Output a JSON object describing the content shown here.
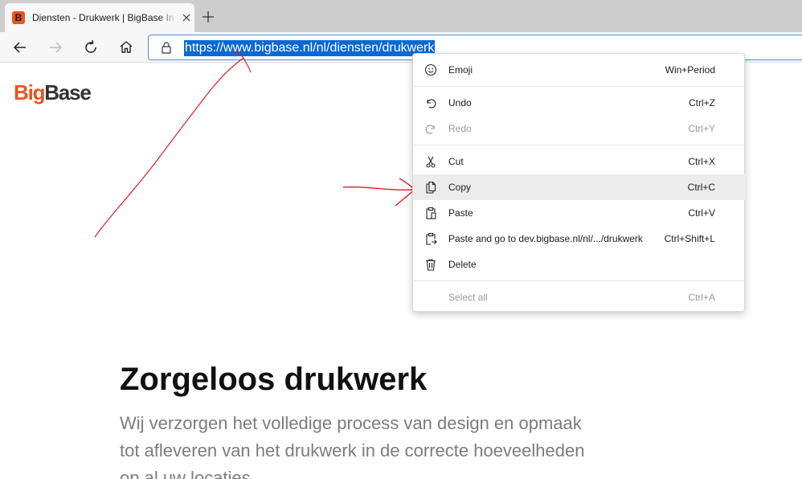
{
  "tab": {
    "title": "Diensten - Drukwerk | BigBase In",
    "favicon_letter": "B"
  },
  "address_bar": {
    "url": "https://www.bigbase.nl/nl/diensten/drukwerk"
  },
  "page": {
    "logo": {
      "part1": "Big",
      "part2": "Base"
    },
    "heading": "Zorgeloos drukwerk",
    "intro": "Wij verzorgen het volledige process van design en opmaak tot afleveren van het drukwerk in de correcte hoeveelheden op al uw locaties."
  },
  "context_menu": {
    "items": [
      {
        "label": "Emoji",
        "shortcut": "Win+Period",
        "icon": "emoji-icon"
      },
      {
        "label": "Undo",
        "shortcut": "Ctrl+Z",
        "icon": "undo-icon"
      },
      {
        "label": "Redo",
        "shortcut": "Ctrl+Y",
        "icon": "redo-icon"
      },
      {
        "label": "Cut",
        "shortcut": "Ctrl+X",
        "icon": "scissors-icon"
      },
      {
        "label": "Copy",
        "shortcut": "Ctrl+C",
        "icon": "copy-icon"
      },
      {
        "label": "Paste",
        "shortcut": "Ctrl+V",
        "icon": "paste-icon"
      },
      {
        "label": "Paste and go to dev.bigbase.nl/nl/.../drukwerk",
        "shortcut": "Ctrl+Shift+L",
        "icon": "paste-go-icon"
      },
      {
        "label": "Delete",
        "shortcut": "",
        "icon": "trash-icon"
      },
      {
        "label": "Select all",
        "shortcut": "Ctrl+A",
        "icon": ""
      }
    ]
  },
  "colors": {
    "brand": "#e8541f",
    "selection": "#0a68d4",
    "focus_ring": "#4a8fe0",
    "annotation": "#d8232a"
  }
}
